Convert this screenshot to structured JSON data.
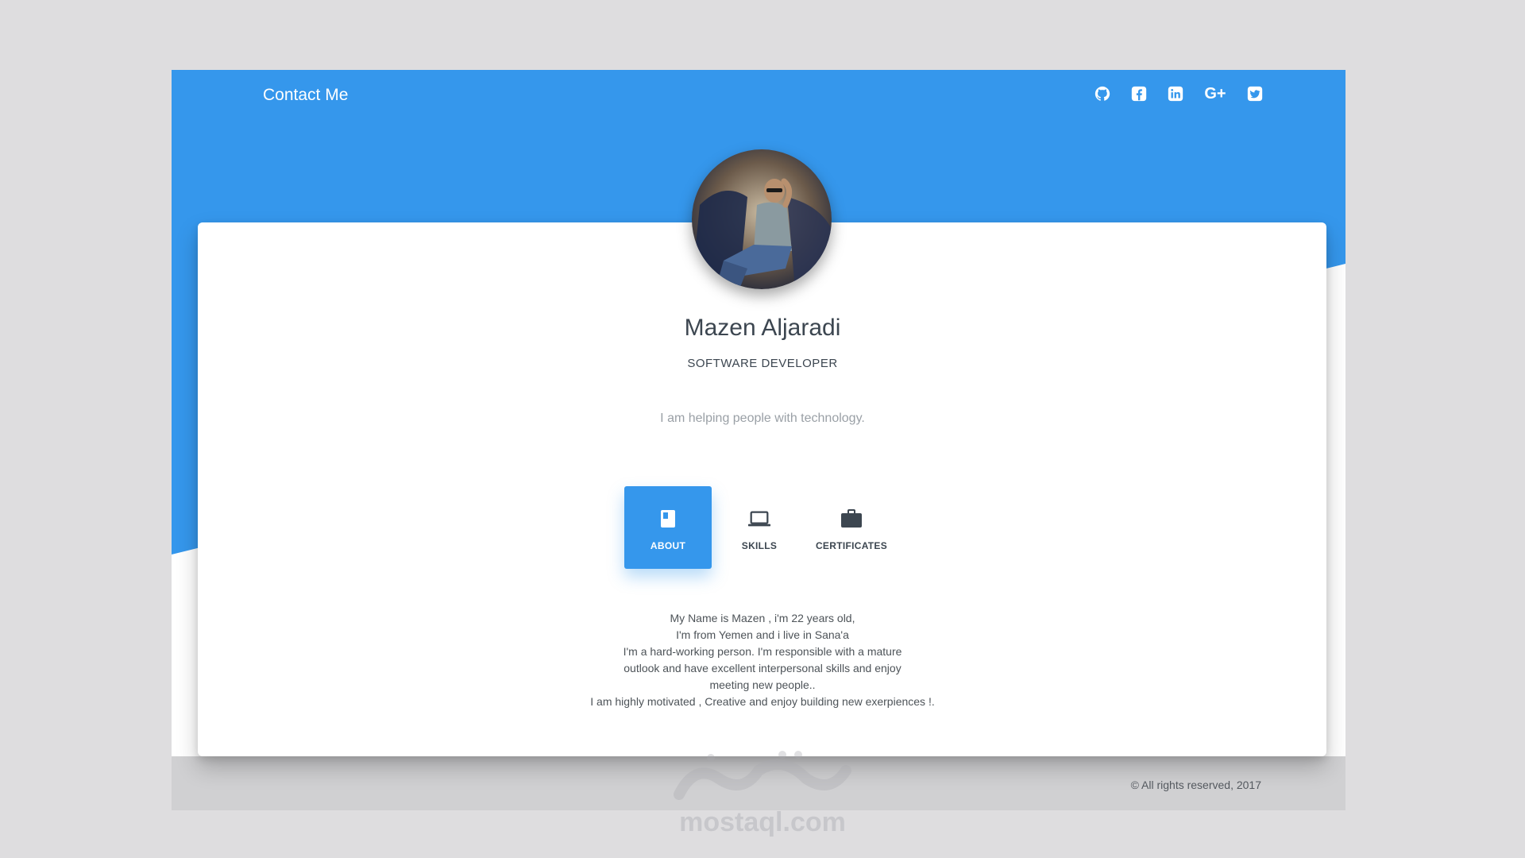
{
  "header": {
    "brand": "Contact Me",
    "social": [
      "github-icon",
      "facebook-icon",
      "linkedin-icon",
      "google-plus-icon",
      "twitter-icon"
    ],
    "gplus_label": "G+"
  },
  "profile": {
    "name": "Mazen Aljaradi",
    "title": "SOFTWARE DEVELOPER",
    "tagline": "I am helping people with technology."
  },
  "tabs": [
    {
      "label": "ABOUT",
      "icon": "book-icon",
      "active": true
    },
    {
      "label": "SKILLS",
      "icon": "laptop-icon",
      "active": false
    },
    {
      "label": "CERTIFICATES",
      "icon": "briefcase-icon",
      "active": false
    }
  ],
  "about": {
    "lines": [
      "My Name is Mazen , i'm 22 years old,",
      "I'm from Yemen and i live in Sana'a",
      "I'm a hard-working person. I'm responsible with a mature",
      "outlook and have excellent interpersonal skills and enjoy",
      "meeting new people..",
      "I am highly motivated , Creative and enjoy building new exerpiences !."
    ]
  },
  "footer": {
    "copyright": "© All rights reserved, 2017"
  },
  "watermark": "mostaql.com",
  "colors": {
    "accent": "#3597ec",
    "page_bg": "#dedddf",
    "footer_bg": "#d0d0d2",
    "text_dark": "#3c4650"
  }
}
